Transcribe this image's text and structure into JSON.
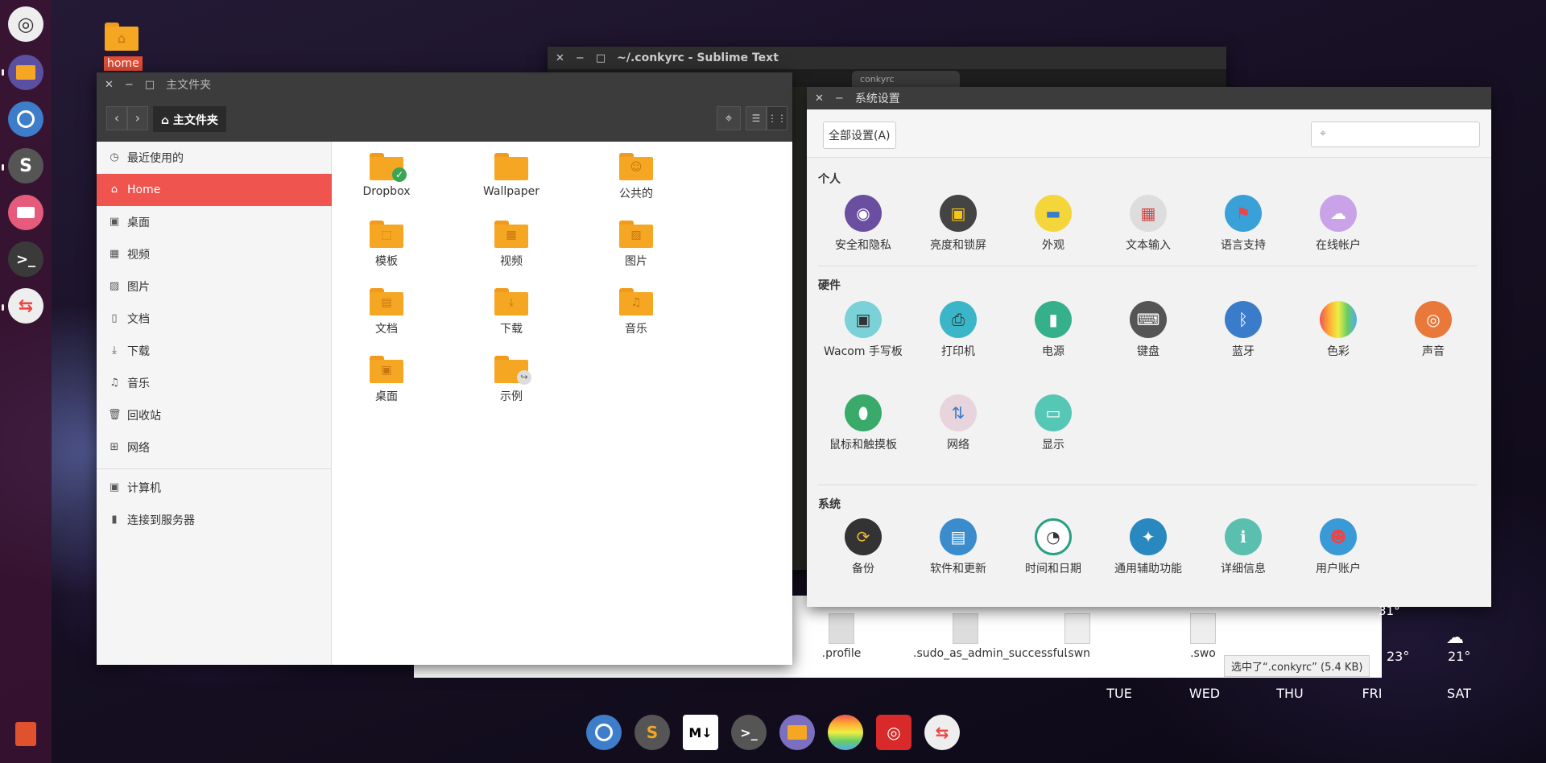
{
  "desktop": {
    "home_label": "home",
    "trash": "trash-icon"
  },
  "launcher": {
    "items": [
      "ubuntu-logo",
      "files",
      "chromium",
      "sublime",
      "unity-tweak",
      "terminal",
      "toggles"
    ]
  },
  "sublime": {
    "title": "~/.conkyrc - Sublime Text",
    "tab1": "",
    "tab2": "conkyrc"
  },
  "nautilus": {
    "title": "主文件夹",
    "path": "主文件夹",
    "sidebar": [
      "最近使用的",
      "Home",
      "桌面",
      "视频",
      "图片",
      "文档",
      "下载",
      "音乐",
      "回收站",
      "网络",
      "计算机",
      "连接到服务器"
    ],
    "files": [
      "Dropbox",
      "Wallpaper",
      "公共的",
      "模板",
      "视频",
      "图片",
      "文档",
      "下载",
      "音乐",
      "桌面",
      "示例"
    ]
  },
  "settings": {
    "title": "系统设置",
    "all_settings": "全部设置(A)",
    "personal": "个人",
    "hardware": "硬件",
    "system": "系统",
    "personal_items": [
      "安全和隐私",
      "亮度和锁屏",
      "外观",
      "文本输入",
      "语言支持",
      "在线帐户"
    ],
    "hardware_items": [
      "Wacom 手写板",
      "打印机",
      "电源",
      "键盘",
      "蓝牙",
      "色彩",
      "声音",
      "鼠标和触摸板",
      "网络",
      "显示"
    ],
    "system_items": [
      "备份",
      "软件和更新",
      "时间和日期",
      "通用辅助功能",
      "详细信息",
      "用户账户"
    ]
  },
  "back_files": {
    "items": [
      ".profile",
      ".sudo_as_admin_successful",
      ".swn",
      ".swo"
    ],
    "status": "选中了“.conkyrc” (5.4 KB)"
  },
  "weather": {
    "temp_top": "31°",
    "temps": [
      "23°",
      "21°"
    ],
    "days": [
      "TUE",
      "WED",
      "THU",
      "FRI",
      "SAT"
    ]
  }
}
